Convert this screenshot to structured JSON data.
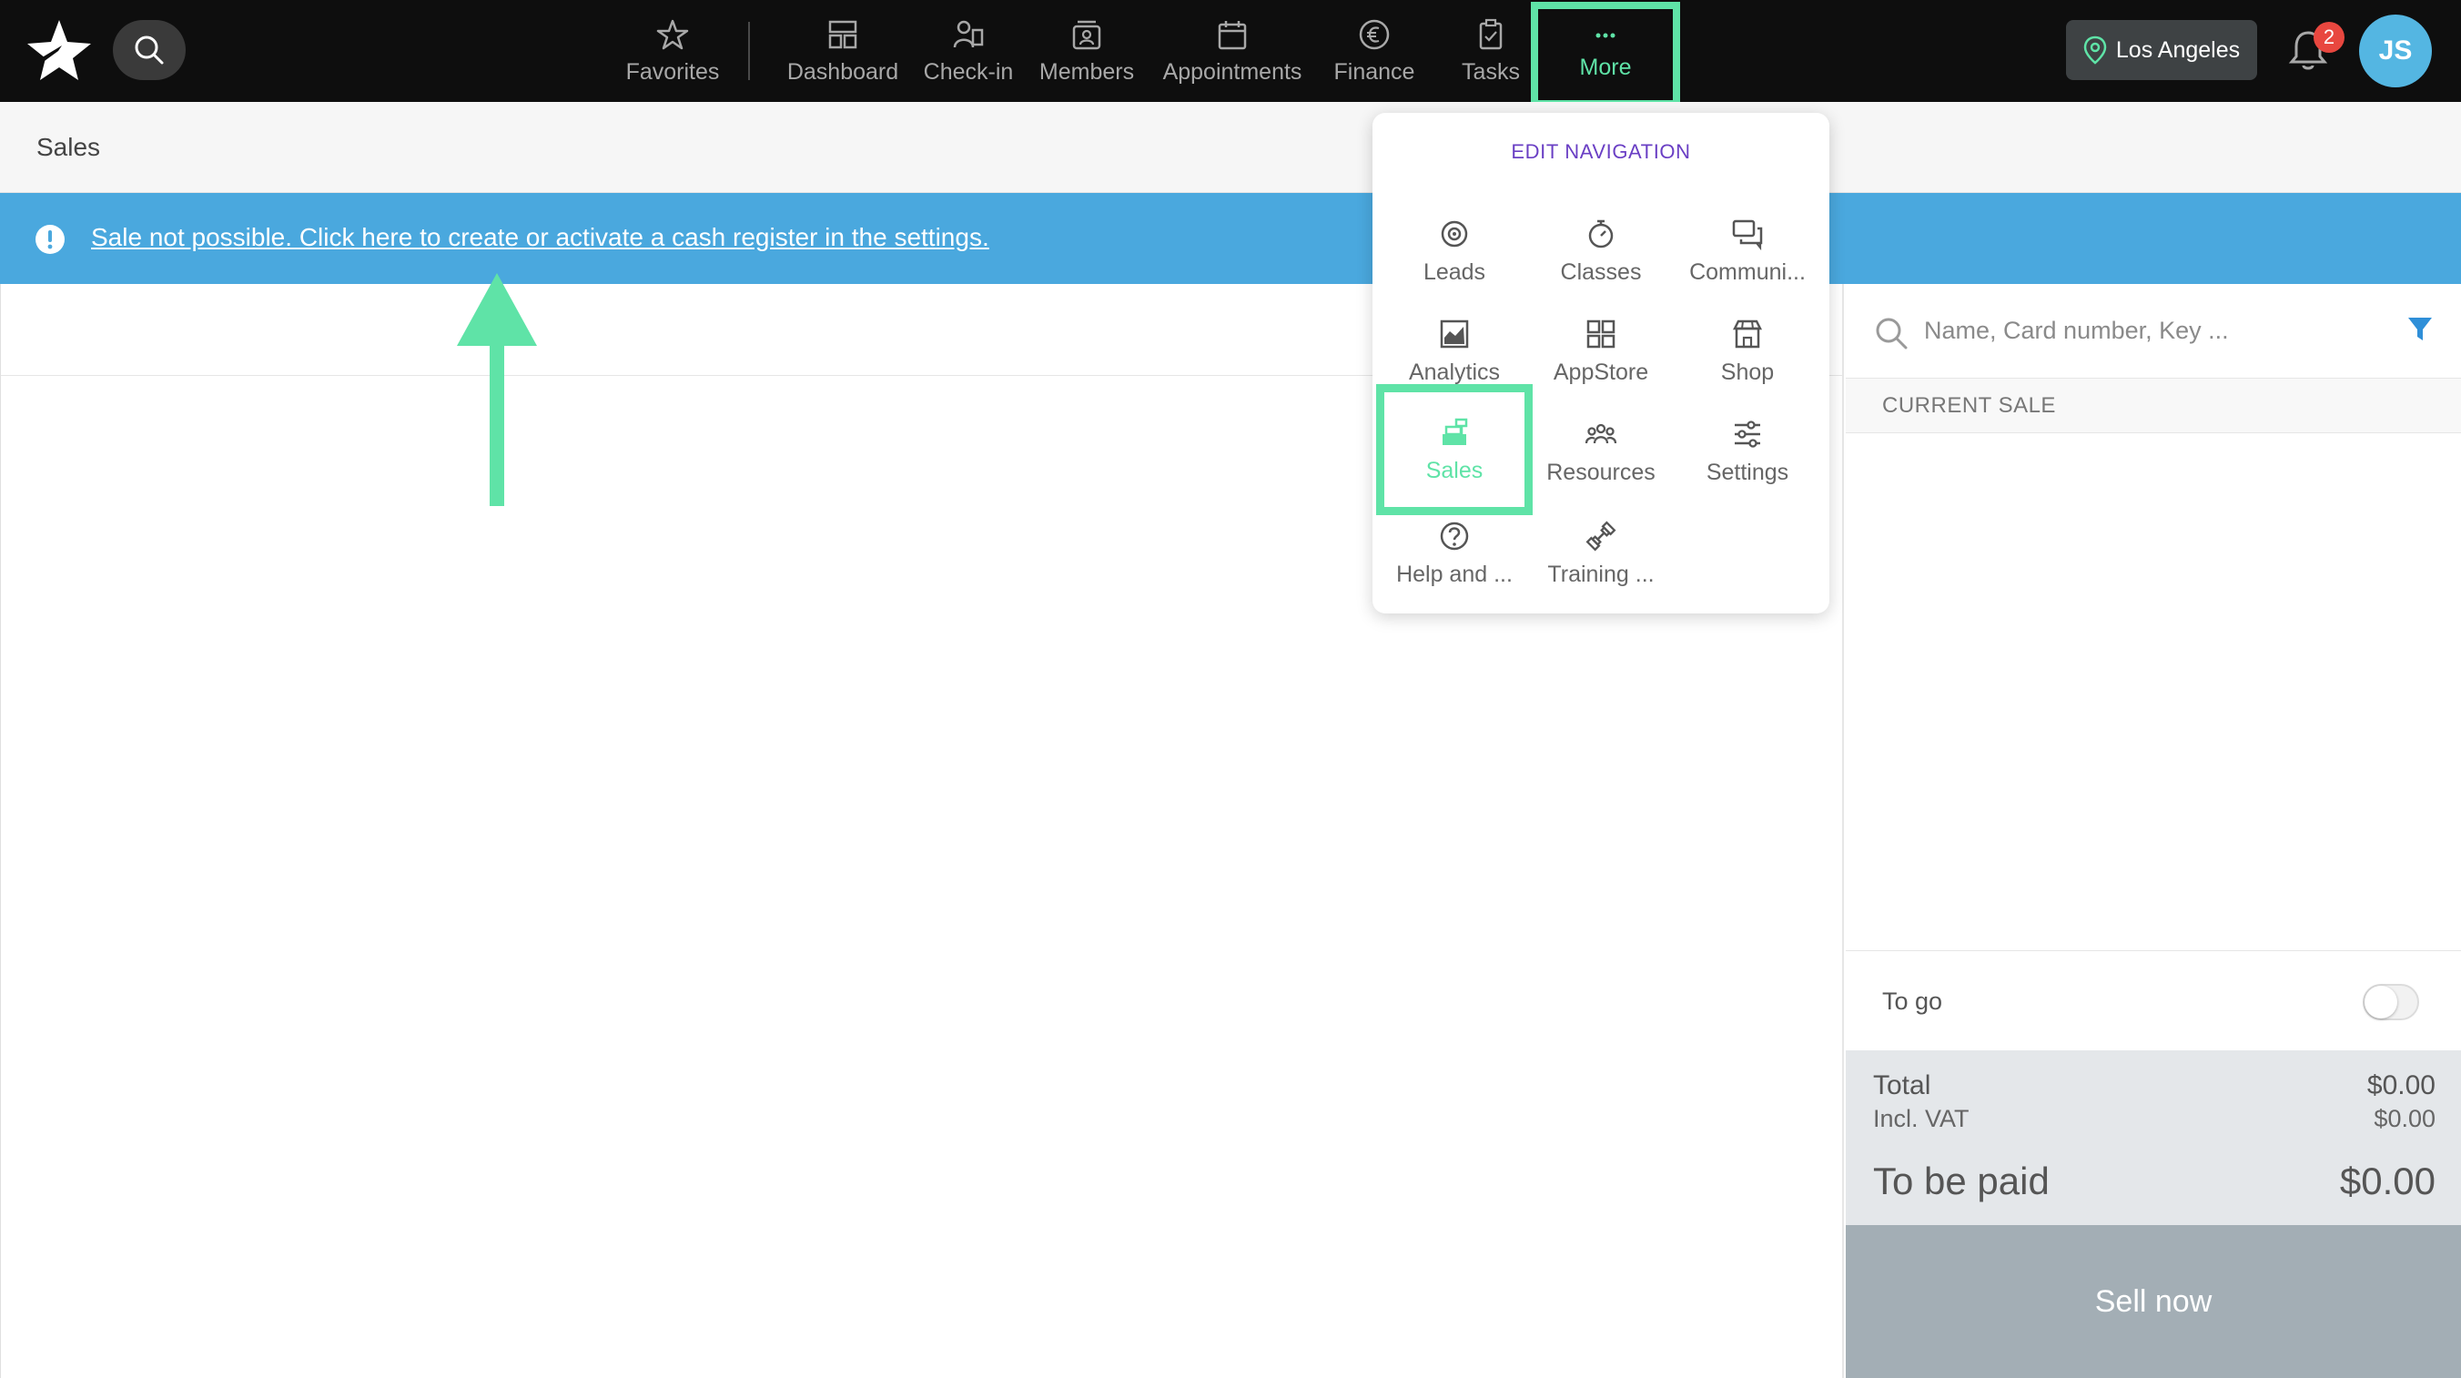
{
  "nav": {
    "items": [
      {
        "label": "Favorites",
        "icon": "star-icon"
      },
      {
        "label": "Dashboard",
        "icon": "dashboard-icon"
      },
      {
        "label": "Check-in",
        "icon": "check-in-icon"
      },
      {
        "label": "Members",
        "icon": "members-icon"
      },
      {
        "label": "Appointments",
        "icon": "calendar-icon"
      },
      {
        "label": "Finance",
        "icon": "euro-icon"
      },
      {
        "label": "Tasks",
        "icon": "clipboard-icon"
      }
    ],
    "more": {
      "label": "More",
      "icon": "ellipsis-icon"
    },
    "location": "Los Angeles",
    "notification_count": "2",
    "avatar_initials": "JS"
  },
  "page": {
    "title": "Sales"
  },
  "alert": {
    "text": "Sale not possible. Click here to create or activate a cash register in the settings."
  },
  "dropdown": {
    "edit_label": "EDIT NAVIGATION",
    "items": [
      {
        "label": "Leads",
        "icon": "target-icon"
      },
      {
        "label": "Classes",
        "icon": "stopwatch-icon"
      },
      {
        "label": "Communi...",
        "icon": "chat-icon"
      },
      {
        "label": "Analytics",
        "icon": "analytics-icon"
      },
      {
        "label": "AppStore",
        "icon": "grid-icon"
      },
      {
        "label": "Shop",
        "icon": "shop-icon"
      },
      {
        "label": "Sales",
        "icon": "cash-register-icon"
      },
      {
        "label": "Resources",
        "icon": "people-icon"
      },
      {
        "label": "Settings",
        "icon": "sliders-icon"
      },
      {
        "label": "Help and ...",
        "icon": "help-icon"
      },
      {
        "label": "Training ...",
        "icon": "dumbbell-icon"
      }
    ]
  },
  "panel": {
    "search_placeholder": "Name, Card number, Key ...",
    "current_sale": "CURRENT SALE",
    "to_go": "To go",
    "total_label": "Total",
    "total_value": "$0.00",
    "vat_label": "Incl. VAT",
    "vat_value": "$0.00",
    "to_be_paid_label": "To be paid",
    "to_be_paid_value": "$0.00",
    "sell_button": "Sell now"
  },
  "colors": {
    "topbar": "#0e0e0e",
    "accent_green": "#5fe3a7",
    "alert_blue": "#4aa8de",
    "edit_nav_purple": "#6a3fc4",
    "avatar_blue": "#54b6e2",
    "badge_red": "#e8473f",
    "sell_button": "#a3aeb5"
  }
}
